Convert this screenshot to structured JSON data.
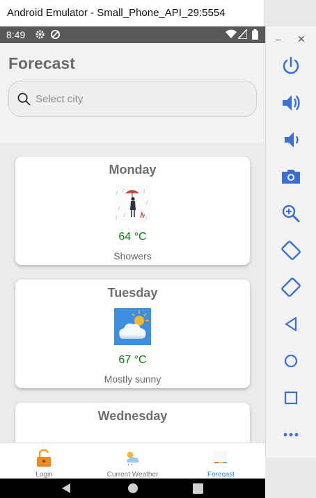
{
  "window": {
    "title": "Android Emulator - Small_Phone_API_29:5554"
  },
  "statusbar": {
    "time": "8:49"
  },
  "page": {
    "title": "Forecast"
  },
  "search": {
    "placeholder": "Select city"
  },
  "forecast": [
    {
      "day": "Monday",
      "temp": "64 °C",
      "condition": "Showers",
      "art": "rain-umbrella-illustration"
    },
    {
      "day": "Tuesday",
      "temp": "67 °C",
      "condition": "Mostly sunny",
      "art": "sun-cloud-illustration"
    },
    {
      "day": "Wednesday",
      "temp": "",
      "condition": "",
      "art": ""
    }
  ],
  "nav": {
    "items": [
      {
        "label": "Login",
        "icon": "padlock-icon",
        "active": false
      },
      {
        "label": "Current Weather",
        "icon": "weather-icon",
        "active": false
      },
      {
        "label": "Forecast",
        "icon": "forecast-icon",
        "active": true
      }
    ]
  },
  "colors": {
    "accent": "#1e88e5",
    "temp": "#0a7a0a",
    "statusbar": "#595959"
  },
  "emulator_controls": [
    "power-icon",
    "volume-up-icon",
    "volume-down-icon",
    "camera-icon",
    "zoom-icon",
    "rotate-left-icon",
    "rotate-right-icon",
    "back-icon",
    "home-icon",
    "overview-icon",
    "more-icon"
  ]
}
